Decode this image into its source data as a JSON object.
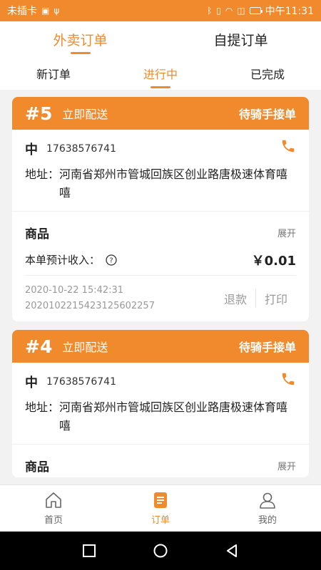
{
  "status_bar": {
    "carrier": "未插卡",
    "time": "中午11:31"
  },
  "top_tabs": [
    {
      "label": "外卖订单",
      "active": true
    },
    {
      "label": "自提订单",
      "active": false
    }
  ],
  "sub_tabs": [
    {
      "label": "新订单",
      "active": false
    },
    {
      "label": "进行中",
      "active": true
    },
    {
      "label": "已完成",
      "active": false
    }
  ],
  "orders": [
    {
      "number": "#5",
      "type": "立即配送",
      "status": "待骑手接单",
      "customer_name": "中",
      "phone": "17638576741",
      "address_label": "地址：",
      "address": "河南省郑州市管城回族区创业路唐极速体育嘻嘻",
      "goods_title": "商品",
      "expand_label": "展开",
      "income_label": "本单预计收入：",
      "income_amount": "￥0.01",
      "datetime": "2020-10-22 15:42:31",
      "order_id": "20201022154231256022​57",
      "refund_label": "退款",
      "print_label": "打印"
    },
    {
      "number": "#4",
      "type": "立即配送",
      "status": "待骑手接单",
      "customer_name": "中",
      "phone": "17638576741",
      "address_label": "地址：",
      "address": "河南省郑州市管城回族区创业路唐极速体育嘻嘻",
      "goods_title": "商品",
      "expand_label": "展开"
    }
  ],
  "bottom_nav": [
    {
      "label": "首页",
      "icon": "home-icon",
      "active": false
    },
    {
      "label": "订单",
      "icon": "order-icon",
      "active": true
    },
    {
      "label": "我的",
      "icon": "profile-icon",
      "active": false
    }
  ],
  "colors": {
    "accent": "#f08a2c"
  }
}
